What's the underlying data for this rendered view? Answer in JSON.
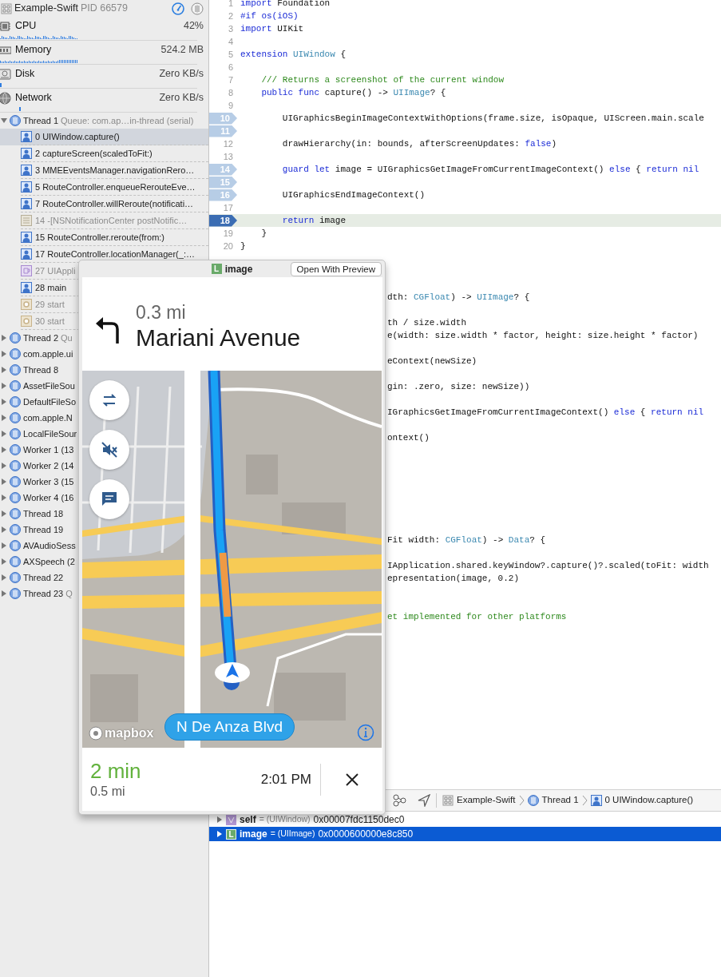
{
  "process": {
    "name": "Example-Swift",
    "pid": "PID 66579"
  },
  "gauges": [
    {
      "kind": "cpu",
      "label": "CPU",
      "value": "42%"
    },
    {
      "kind": "memory",
      "label": "Memory",
      "value": "524.2 MB"
    },
    {
      "kind": "disk",
      "label": "Disk",
      "value": "Zero KB/s"
    },
    {
      "kind": "network",
      "label": "Network",
      "value": "Zero KB/s"
    }
  ],
  "threads": [
    {
      "name": "Thread 1",
      "queue": "Queue: com.ap…in-thread (serial)",
      "expanded": true,
      "selected": false,
      "children": [
        {
          "kind": "user",
          "label": "0 UIWindow.capture()",
          "selected": true
        },
        {
          "kind": "user",
          "label": "2 captureScreen(scaledToFit:)",
          "selected": false
        },
        {
          "kind": "user",
          "label": "3 MMEEventsManager.navigationRero…",
          "selected": false
        },
        {
          "kind": "user",
          "label": "5 RouteController.enqueueRerouteEve…",
          "selected": false
        },
        {
          "kind": "user",
          "label": "7 RouteController.willReroute(notificati…",
          "selected": false
        },
        {
          "kind": "system",
          "label": "14 -[NSNotificationCenter postNotific…",
          "selected": false
        },
        {
          "kind": "user",
          "label": "15 RouteController.reroute(from:)",
          "selected": false
        },
        {
          "kind": "user",
          "label": "17 RouteController.locationManager(_:…",
          "selected": false
        },
        {
          "kind": "app",
          "label": "27 UIAppli",
          "selected": false
        },
        {
          "kind": "user",
          "label": "28 main",
          "selected": false
        },
        {
          "kind": "start",
          "label": "29 start",
          "selected": false
        },
        {
          "kind": "start",
          "label": "30 start",
          "selected": false
        }
      ]
    },
    {
      "name": "Thread 2",
      "queue": "Qu",
      "expanded": false,
      "selected": false
    },
    {
      "name": "com.apple.ui",
      "expanded": false,
      "selected": false
    },
    {
      "name": "Thread 8",
      "expanded": false,
      "selected": false
    },
    {
      "name": "AssetFileSou",
      "expanded": false,
      "selected": false
    },
    {
      "name": "DefaultFileSo",
      "expanded": false,
      "selected": false
    },
    {
      "name": "com.apple.N",
      "expanded": false,
      "selected": false
    },
    {
      "name": "LocalFileSour",
      "expanded": false,
      "selected": false
    },
    {
      "name": "Worker 1 (13",
      "expanded": false,
      "selected": false
    },
    {
      "name": "Worker 2 (14",
      "expanded": false,
      "selected": false
    },
    {
      "name": "Worker 3 (15",
      "expanded": false,
      "selected": false
    },
    {
      "name": "Worker 4 (16",
      "expanded": false,
      "selected": false
    },
    {
      "name": "Thread 18",
      "expanded": false,
      "selected": false
    },
    {
      "name": "Thread 19",
      "expanded": false,
      "selected": false
    },
    {
      "name": "AVAudioSess",
      "expanded": false,
      "selected": false
    },
    {
      "name": "AXSpeech (2",
      "expanded": false,
      "selected": false
    },
    {
      "name": "Thread 22",
      "expanded": false,
      "selected": false
    },
    {
      "name": "Thread 23",
      "queue": "Q",
      "expanded": false,
      "selected": false
    }
  ],
  "editor": {
    "lines": [
      {
        "number": "1",
        "breakpoint": false,
        "current": false,
        "tokens": [
          {
            "kind": "keyword",
            "text": "import"
          },
          {
            "kind": "plain",
            "text": " Foundation"
          }
        ]
      },
      {
        "number": "2",
        "breakpoint": false,
        "current": false,
        "tokens": [
          {
            "kind": "keyword",
            "text": "#if os(iOS)"
          }
        ]
      },
      {
        "number": "3",
        "breakpoint": false,
        "current": false,
        "tokens": [
          {
            "kind": "keyword",
            "text": "import"
          },
          {
            "kind": "plain",
            "text": " UIKit"
          }
        ]
      },
      {
        "number": "4",
        "breakpoint": false,
        "current": false
      },
      {
        "number": "5",
        "breakpoint": false,
        "current": false,
        "tokens": [
          {
            "kind": "keyword",
            "text": "extension "
          },
          {
            "kind": "type",
            "text": "UIWindow"
          },
          {
            "kind": "plain",
            "text": " {"
          }
        ]
      },
      {
        "number": "6",
        "breakpoint": false,
        "current": false
      },
      {
        "number": "7",
        "breakpoint": false,
        "current": false,
        "tokens": [
          {
            "kind": "comment",
            "text": "    /// Returns a screenshot of the current window"
          }
        ]
      },
      {
        "number": "8",
        "breakpoint": false,
        "current": false,
        "tokens": [
          {
            "kind": "keyword",
            "text": "    public func"
          },
          {
            "kind": "plain",
            "text": " capture() -> "
          },
          {
            "kind": "type",
            "text": "UIImage"
          },
          {
            "kind": "plain",
            "text": "? {"
          }
        ]
      },
      {
        "number": "9",
        "breakpoint": false,
        "current": false
      },
      {
        "number": "10",
        "breakpoint": true,
        "current": false,
        "tokens": [
          {
            "kind": "plain",
            "text": "        UIGraphicsBeginImageContextWithOptions(frame.size, isOpaque, UIScreen.main.scale"
          }
        ]
      },
      {
        "number": "11",
        "breakpoint": true,
        "current": false
      },
      {
        "number": "12",
        "breakpoint": false,
        "current": false,
        "tokens": [
          {
            "kind": "plain",
            "text": "        drawHierarchy(in: bounds, afterScreenUpdates: "
          },
          {
            "kind": "keyword",
            "text": "false"
          },
          {
            "kind": "plain",
            "text": ")"
          }
        ]
      },
      {
        "number": "13",
        "breakpoint": false,
        "current": false
      },
      {
        "number": "14",
        "breakpoint": true,
        "current": false,
        "tokens": [
          {
            "kind": "keyword",
            "text": "        guard let"
          },
          {
            "kind": "plain",
            "text": " image = UIGraphicsGetImageFromCurrentImageContext() "
          },
          {
            "kind": "keyword",
            "text": "else"
          },
          {
            "kind": "plain",
            "text": " { "
          },
          {
            "kind": "keyword",
            "text": "return nil"
          }
        ]
      },
      {
        "number": "15",
        "breakpoint": true,
        "current": false
      },
      {
        "number": "16",
        "breakpoint": true,
        "current": false,
        "tokens": [
          {
            "kind": "plain",
            "text": "        UIGraphicsEndImageContext()"
          }
        ]
      },
      {
        "number": "17",
        "breakpoint": false,
        "current": false
      },
      {
        "number": "18",
        "breakpoint": true,
        "current": true,
        "tokens": [
          {
            "kind": "keyword",
            "text": "        return"
          },
          {
            "kind": "plain",
            "text": " image"
          }
        ]
      },
      {
        "number": "19",
        "breakpoint": false,
        "current": false,
        "tokens": [
          {
            "kind": "plain",
            "text": "    }"
          }
        ]
      },
      {
        "number": "20",
        "breakpoint": false,
        "current": false,
        "tokens": [
          {
            "kind": "plain",
            "text": "}"
          }
        ]
      }
    ],
    "partly_hidden_lines": [
      {
        "tokens": [
          {
            "kind": "plain",
            "text": "dth: "
          },
          {
            "kind": "type",
            "text": "CGFloat"
          },
          {
            "kind": "plain",
            "text": ") -> "
          },
          {
            "kind": "type",
            "text": "UIImage"
          },
          {
            "kind": "plain",
            "text": "? {"
          }
        ]
      },
      {
        "tokens": [
          {
            "kind": "plain",
            "text": "th / size.width"
          }
        ]
      },
      {
        "tokens": [
          {
            "kind": "plain",
            "text": "e(width: size.width * factor, height: size.height * factor)"
          }
        ]
      },
      {
        "tokens": [
          {
            "kind": "plain",
            "text": "eContext(newSize)"
          }
        ]
      },
      {
        "tokens": [
          {
            "kind": "plain",
            "text": "gin: .zero, size: newSize))"
          }
        ]
      },
      {
        "tokens": [
          {
            "kind": "plain",
            "text": "IGraphicsGetImageFromCurrentImageContext() "
          },
          {
            "kind": "keyword",
            "text": "else"
          },
          {
            "kind": "plain",
            "text": " { "
          },
          {
            "kind": "keyword",
            "text": "return nil"
          }
        ]
      },
      {
        "tokens": [
          {
            "kind": "plain",
            "text": "ontext()"
          }
        ]
      },
      {
        "tokens": [
          {
            "kind": "plain",
            "text": "Fit width: "
          },
          {
            "kind": "type",
            "text": "CGFloat"
          },
          {
            "kind": "plain",
            "text": ") -> "
          },
          {
            "kind": "type",
            "text": "Data"
          },
          {
            "kind": "plain",
            "text": "? {"
          }
        ]
      },
      {
        "tokens": [
          {
            "kind": "plain",
            "text": "IApplication.shared.keyWindow?.capture()?.scaled(toFit: width"
          }
        ]
      },
      {
        "tokens": [
          {
            "kind": "plain",
            "text": "epresentation(image, 0.2)"
          }
        ]
      },
      {
        "tokens": [
          {
            "kind": "comment",
            "text": "et implemented for other platforms"
          }
        ]
      }
    ]
  },
  "debug_bar": {
    "breadcrumbs": [
      {
        "kind": "app",
        "label": "Example-Swift"
      },
      {
        "kind": "thread",
        "label": "Thread 1"
      },
      {
        "kind": "frame",
        "label": "0 UIWindow.capture()"
      }
    ]
  },
  "variables": [
    {
      "kind": "self",
      "name": "self",
      "type": "= (UIWindow)",
      "value": "0x00007fdc1150dec0",
      "selected": false
    },
    {
      "kind": "local",
      "badge": "L",
      "name": "image",
      "type": "= (UIImage)",
      "value": "0x0000600000e8c850",
      "selected": true
    }
  ],
  "popover": {
    "badge": "L",
    "title": "image",
    "button": "Open With Preview",
    "preview": {
      "maneuver": {
        "distance": "0.3 mi",
        "street": "Mariani Avenue"
      },
      "map_buttons": [
        {
          "kind": "overview"
        },
        {
          "kind": "mute"
        },
        {
          "kind": "feedback"
        }
      ],
      "road_label": "N De Anza Blvd",
      "attribution": "mapbox",
      "eta": {
        "duration": "2 min",
        "distance": "0.5 mi",
        "arrival": "2:01 PM"
      }
    }
  }
}
